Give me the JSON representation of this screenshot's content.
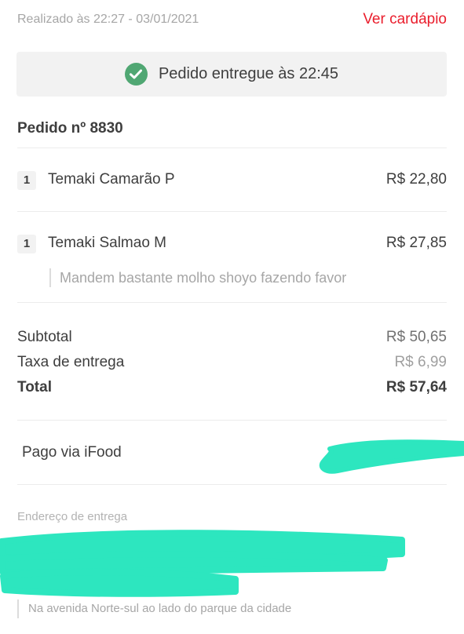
{
  "header": {
    "placed_at": "Realizado às 22:27 - 03/01/2021",
    "menu_link": "Ver cardápio"
  },
  "status": {
    "text": "Pedido entregue às 22:45",
    "icon": "check-circle-icon",
    "icon_color": "#50a773"
  },
  "order": {
    "number_label": "Pedido nº 8830",
    "items": [
      {
        "qty": "1",
        "name": "Temaki Camarão P",
        "price": "R$ 22,80"
      },
      {
        "qty": "1",
        "name": "Temaki Salmao M",
        "price": "R$ 27,85",
        "note": "Mandem bastante molho shoyo fazendo favor"
      }
    ]
  },
  "summary": {
    "subtotal_label": "Subtotal",
    "subtotal_value": "R$ 50,65",
    "fee_label": "Taxa de entrega",
    "fee_value": "R$ 6,99",
    "total_label": "Total",
    "total_value": "R$ 57,64"
  },
  "payment": {
    "label": "Pago via iFood"
  },
  "address": {
    "label": "Endereço de entrega",
    "reference": "Na avenida Norte-sul ao lado do parque da cidade"
  },
  "colors": {
    "accent": "#ea1d2c",
    "redaction": "#2de6bf"
  }
}
